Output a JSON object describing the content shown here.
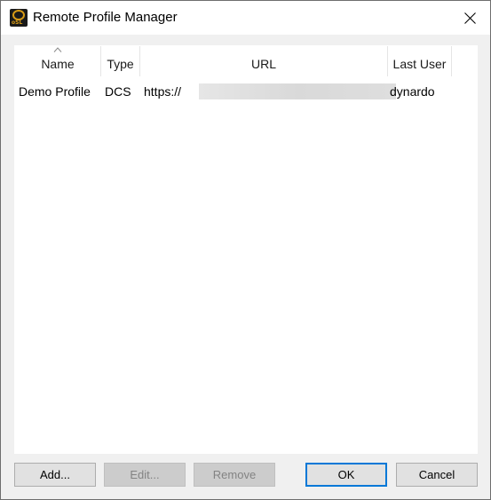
{
  "window": {
    "title": "Remote Profile Manager",
    "app_icon": "dynardo-app-icon",
    "app_icon_sub": "oSL",
    "close_icon": "close-icon"
  },
  "list": {
    "columns": [
      {
        "label": "Name",
        "sorted": "ascending"
      },
      {
        "label": "Type"
      },
      {
        "label": "URL"
      },
      {
        "label": "Last User"
      }
    ],
    "rows": [
      {
        "name": "Demo Profile",
        "type": "DCS",
        "url": "https://",
        "last_user": "dynardo"
      }
    ]
  },
  "buttons": {
    "add": "Add...",
    "edit": "Edit...",
    "remove": "Remove",
    "ok": "OK",
    "cancel": "Cancel"
  },
  "colors": {
    "default_button_border": "#0078d7",
    "disabled_text": "#838383"
  }
}
